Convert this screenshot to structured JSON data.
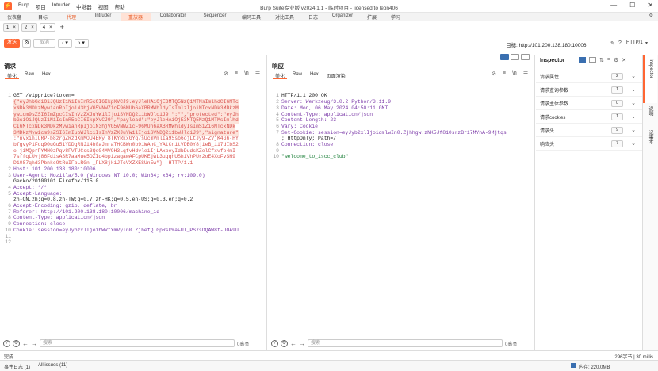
{
  "titlebar": {
    "menus": [
      "Burp",
      "项目",
      "Intruder",
      "中继器",
      "视图",
      "帮助"
    ],
    "title": "Burp Suite专业版  v2024.1.1 - 临时项目 - licensed to leon406"
  },
  "tabs_row1": [
    "仪表盘",
    "目标",
    "代理",
    "Intruder",
    "重放器",
    "Collaborator",
    "Sequencer",
    "编码工具",
    "对比工具",
    "日志",
    "Organizer",
    "扩展",
    "学习"
  ],
  "tabs_row1_active": "重放器",
  "request_tabs": [
    {
      "num": "1",
      "close": "×"
    },
    {
      "num": "2",
      "close": "×"
    },
    {
      "num": "4",
      "close": "×"
    }
  ],
  "add_tab": "+",
  "toolbar": {
    "send": "发送",
    "cancel": "取消",
    "target_label": "目标: http://101.200.138.180:10006",
    "http_version": "HTTP/1"
  },
  "request": {
    "title": "请求",
    "tabs": [
      "美化",
      "Raw",
      "Hex"
    ],
    "lines": [
      {
        "n": "1",
        "t": "GET /vipprice?token="
      },
      {
        "n": "",
        "t": "{\"eyJhbGciOiJQUzI1NiIsInR5cCI6IkpXVCJ9.eyJleHAiOjE3MTQ5NzQ1MTMsImlhdCI6MTc"
      },
      {
        "n": "",
        "t": "xNDk3MDkzMywianRpIjoiN3hjVG5VNWZicF96MUh6aXBRMWhldyIsImlzIjoiMTcxNDk3MDkzM"
      },
      {
        "n": "",
        "t": "ywicm9sZSI6ImZpcCIsInVzZXJuYW1lIjoiSVNDQ211bWJlciJ9.\":\"\",\"protected\":\"eyJh"
      },
      {
        "n": "",
        "t": "bGciOiJQUzI1NiIsInR5cCI6IkpXVCJ9\",\"payload\":\"eyJleHAiOjE3MTQ5NzQ1MTMsImlhd"
      },
      {
        "n": "",
        "t": "CI6MTcxNDk3MDkzMywianRpIjoiN3hjVG5VNWZicF96MUh6aXBRMWhldyIsImSiZi6MTcxNDk"
      },
      {
        "n": "",
        "t": "3MDkzMywicm9sZSI6ImIubWJlciIsInVzZXJuYW1lIjoiSVNDQ211bWJlciJ9\",\"signature\""
      },
      {
        "n": "",
        "t": ":\"nvxihIURP-b8zrgZRzdXmMOU4ERy_8TKYRkxGYq7sUcmVmlia9Ssb6ojLtJy9-ZVjK4G6-HY"
      },
      {
        "n": "",
        "t": "bfgvyP1Fcq90uGu51YDDgRNJi4h0aJmraTHCBWn0b91WAnC_YAtCnitVDB0Y8jieB_ii7dIbS2"
      },
      {
        "n": "",
        "t": "o-jiMQprPYMH0zPqv8FVTUCss3QsG4MV9H3LqfvHdvleiIjLAxpeyIdbDudsKZelCfxvfo4mI"
      },
      {
        "n": "",
        "t": "7sffqLUyj86Fd1sASR7aaMue5OZIq4bpizagawAFCpUKEjwL3uqqhUShiVhPUr2oE4XoFvSH9"
      },
      {
        "n": "",
        "t": "D10S7qhd3Pbnkc9tRuIFbLRGn-_FLX8jkiJTcVXZXESUnEw\"}  HTTP/1.1"
      },
      {
        "n": "2",
        "t": "Host: 101.200.138.180:10006"
      },
      {
        "n": "3",
        "t": "User-Agent: Mozilla/5.0 (Windows NT 10.0; Win64; x64; rv:109.0)"
      },
      {
        "n": "",
        "t": "Gecko/20100101 Firefox/115.0"
      },
      {
        "n": "4",
        "t": "Accept: */*"
      },
      {
        "n": "5",
        "t": "Accept-Language:"
      },
      {
        "n": "",
        "t": "zh-CN,zh;q=0.8,zh-TW;q=0.7,zh-HK;q=0.5,en-US;q=0.3,en;q=0.2"
      },
      {
        "n": "6",
        "t": "Accept-Encoding: gzip, deflate, br"
      },
      {
        "n": "7",
        "t": "Referer: http://101.200.138.180:10006/machine_id"
      },
      {
        "n": "8",
        "t": "Content-Type: application/json"
      },
      {
        "n": "9",
        "t": "Connection: close"
      },
      {
        "n": "10",
        "t": "Cookie: session=eyJybzxlIjoibWVtYmVyIn0.ZjhefQ.GpRsk%aFUT_PS7sDQAW8t-JOA9U"
      },
      {
        "n": "11",
        "t": ""
      },
      {
        "n": "12",
        "t": ""
      }
    ],
    "search_placeholder": "搜索",
    "highlights": "0高亮"
  },
  "response": {
    "title": "响应",
    "tabs": [
      "美化",
      "Raw",
      "Hex",
      "页面渲染"
    ],
    "lines": [
      {
        "n": "1",
        "t": "HTTP/1.1 200 OK"
      },
      {
        "n": "2",
        "t": "Server: Werkzeug/3.0.2 Python/3.11.9"
      },
      {
        "n": "3",
        "t": "Date: Mon, 06 May 2024 04:50:11 GMT"
      },
      {
        "n": "4",
        "t": "Content-Type: application/json"
      },
      {
        "n": "5",
        "t": "Content-Length: 23"
      },
      {
        "n": "6",
        "t": "Vary: Cookie"
      },
      {
        "n": "7",
        "t": "Set-Cookie: session=eyJyb2xlIjoidmlwIn0.Zjhhgw.zNK5Jf810srzBri7MYnA-9Mjtqs"
      },
      {
        "n": "",
        "t": "; HttpOnly; Path=/"
      },
      {
        "n": "8",
        "t": "Connection: close"
      },
      {
        "n": "9",
        "t": ""
      },
      {
        "n": "10",
        "t": "\"welcome_to_iscc_club\""
      }
    ],
    "search_placeholder": "搜索",
    "highlights": "0高亮"
  },
  "inspector": {
    "title": "Inspector",
    "rows": [
      {
        "label": "请求属性",
        "count": "2"
      },
      {
        "label": "请求查询参数",
        "count": "1"
      },
      {
        "label": "请求主体参数",
        "count": "0"
      },
      {
        "label": "请求cookies",
        "count": "1"
      },
      {
        "label": "请求头",
        "count": "9"
      },
      {
        "label": "响应头",
        "count": "7"
      }
    ]
  },
  "sidebar_tabs": [
    "Inspector",
    "说明",
    "记事本"
  ],
  "status": {
    "left": "完成",
    "right": "296字节 | 30 millis"
  },
  "bottombar": {
    "event_log": "事件日志 (1)",
    "all_issues": "All issues (11)",
    "memory": "内存: 220.0MB"
  }
}
